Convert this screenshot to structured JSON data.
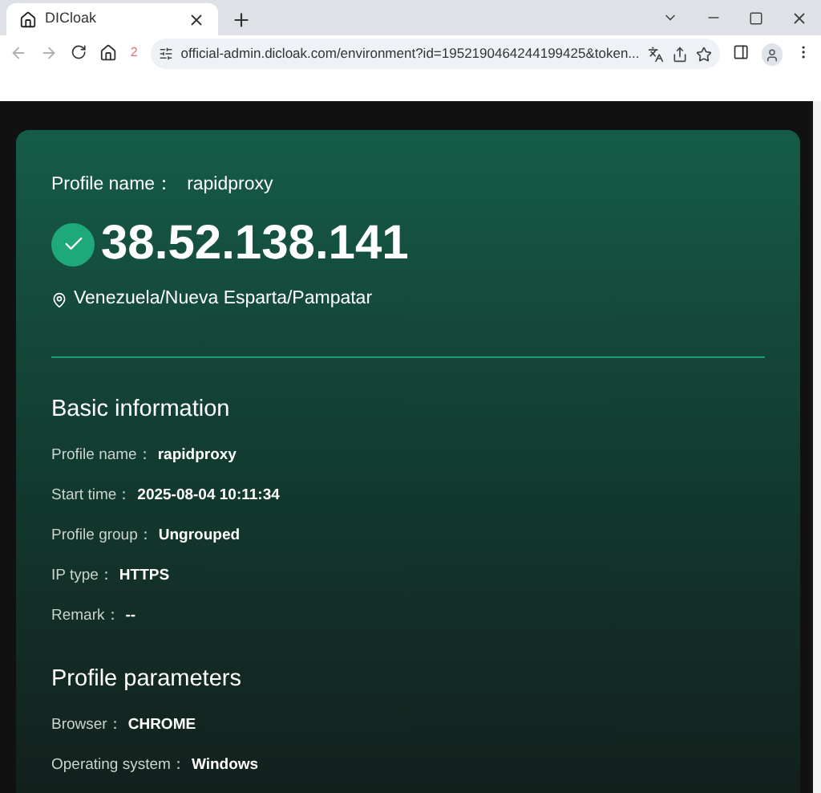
{
  "browser": {
    "tab": {
      "title": "DICloak",
      "selected": true
    },
    "nav": {
      "back_disabled": true,
      "forward_disabled": true,
      "badge": "2"
    },
    "url": "official-admin.dicloak.com/environment?id=1952190464244199425&token..."
  },
  "header": {
    "profile_label": "Profile name：",
    "profile_value": "rapidproxy",
    "ip": "38.52.138.141",
    "location": "Venezuela/Nueva Esparta/Pampatar"
  },
  "sections": [
    {
      "title": "Basic information",
      "rows": [
        {
          "label": "Profile name：",
          "value": "rapidproxy"
        },
        {
          "label": "Start time：",
          "value": "2025-08-04 10:11:34"
        },
        {
          "label": "Profile group：",
          "value": "Ungrouped"
        },
        {
          "label": "IP type：",
          "value": "HTTPS"
        },
        {
          "label": "Remark：",
          "value": "--"
        }
      ]
    },
    {
      "title": "Profile parameters",
      "rows": [
        {
          "label": "Browser：",
          "value": "CHROME"
        },
        {
          "label": "Operating system：",
          "value": "Windows"
        }
      ]
    }
  ]
}
